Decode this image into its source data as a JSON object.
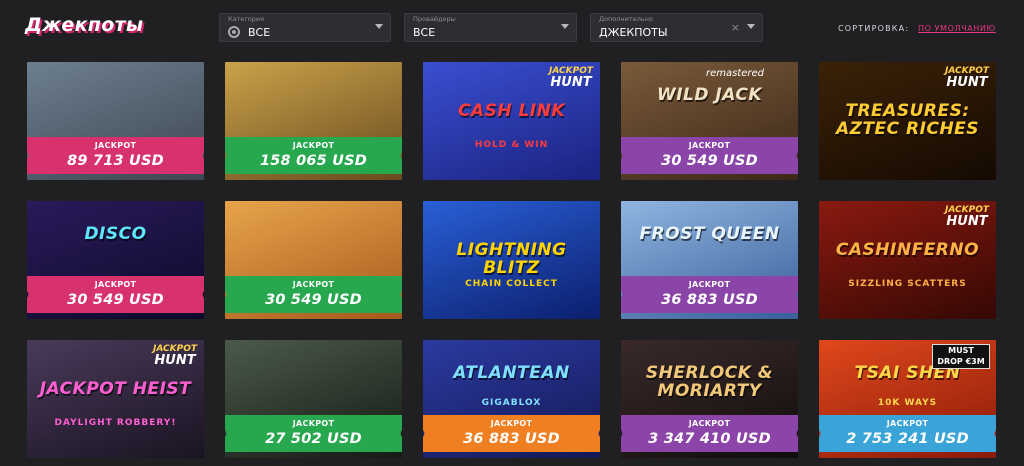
{
  "page": {
    "title": "Джекпоты"
  },
  "filters": [
    {
      "label": "Категория",
      "value": "ВСЕ",
      "has_icon": true,
      "clearable": false
    },
    {
      "label": "Провайдеры",
      "value": "ВСЕ",
      "has_icon": false,
      "clearable": false
    },
    {
      "label": "Дополнительно",
      "value": "ДЖЕКПОТЫ",
      "has_icon": false,
      "clearable": true,
      "clear_glyph": "×"
    }
  ],
  "sort": {
    "label": "СОРТИРОВКА:",
    "value": "ПО УМОЛЧАНИЮ"
  },
  "jackpot_label": "JACKPOT",
  "badges": {
    "jackpot_hunt_1": "JACKPOT",
    "jackpot_hunt_2": "HUNT",
    "remastered": "remastered",
    "must_drop_1": "MUST",
    "must_drop_2": "DROP €3M"
  },
  "games": [
    {
      "name": "",
      "sub": "",
      "art": [
        "#6d7f8f",
        "#3d4652"
      ],
      "text_color": "#fff",
      "badge": "",
      "ribbon_color": "#d8326e",
      "amount": "89 713 USD"
    },
    {
      "name": "",
      "sub": "",
      "art": [
        "#c9a24a",
        "#6a4a1e"
      ],
      "text_color": "#fff",
      "badge": "",
      "ribbon_color": "#27a74e",
      "amount": "158 065 USD"
    },
    {
      "name": "CASH LINK",
      "sub": "HOLD & WIN",
      "art": [
        "#3a4fd1",
        "#1b2280"
      ],
      "text_color": "#ff3b3b",
      "badge": "jackpot_hunt",
      "ribbon_color": "",
      "amount": ""
    },
    {
      "name": "WILD JACK",
      "sub": "",
      "art": [
        "#7a5a3a",
        "#3b2818"
      ],
      "text_color": "#f0e2c2",
      "badge": "remastered",
      "ribbon_color": "#8b45a8",
      "amount": "30 549 USD"
    },
    {
      "name": "TREASURES: AZTEC RICHES",
      "sub": "",
      "art": [
        "#3b2208",
        "#150a02"
      ],
      "text_color": "#ffcc33",
      "badge": "jackpot_hunt",
      "ribbon_color": "",
      "amount": ""
    },
    {
      "name": "DISCO",
      "sub": "",
      "art": [
        "#2a1a5a",
        "#0d0a2a"
      ],
      "text_color": "#5fe7ff",
      "badge": "",
      "ribbon_color": "#d8326e",
      "amount": "30 549 USD"
    },
    {
      "name": "",
      "sub": "",
      "art": [
        "#e8a44a",
        "#a55a1e"
      ],
      "text_color": "#fff",
      "badge": "",
      "ribbon_color": "#27a74e",
      "amount": "30 549 USD"
    },
    {
      "name": "LIGHTNING BLITZ",
      "sub": "CHAIN COLLECT",
      "art": [
        "#2a5fd6",
        "#0b1f6e"
      ],
      "text_color": "#ffd400",
      "badge": "",
      "ribbon_color": "",
      "amount": ""
    },
    {
      "name": "FROST QUEEN",
      "sub": "",
      "art": [
        "#8fb6e0",
        "#3a5e9a"
      ],
      "text_color": "#eaf6ff",
      "badge": "",
      "ribbon_color": "#8b45a8",
      "amount": "36 883 USD"
    },
    {
      "name": "CASHINFERNO",
      "sub": "SIZZLING SCATTERS",
      "art": [
        "#8a1a10",
        "#350804"
      ],
      "text_color": "#ffb347",
      "badge": "jackpot_hunt",
      "ribbon_color": "",
      "amount": ""
    },
    {
      "name": "JACKPOT HEIST",
      "sub": "DAYLIGHT ROBBERY!",
      "art": [
        "#4a3a5a",
        "#1a1422"
      ],
      "text_color": "#ff5fd1",
      "badge": "jackpot_hunt",
      "ribbon_color": "",
      "amount": ""
    },
    {
      "name": "",
      "sub": "",
      "art": [
        "#4a5a4a",
        "#151a15"
      ],
      "text_color": "#fff",
      "badge": "",
      "ribbon_color": "#27a74e",
      "amount": "27 502 USD"
    },
    {
      "name": "ATLANTEAN",
      "sub": "GIGABLOX",
      "art": [
        "#2b3aa0",
        "#151855"
      ],
      "text_color": "#7fe0ff",
      "badge": "",
      "ribbon_color": "#f07f22",
      "amount": "36 883 USD"
    },
    {
      "name": "SHERLOCK & MORIARTY",
      "sub": "",
      "art": [
        "#3a2a2a",
        "#120c0c"
      ],
      "text_color": "#f2c97a",
      "badge": "",
      "ribbon_color": "#8b45a8",
      "amount": "3 347 410 USD"
    },
    {
      "name": "TSAI SHEN",
      "sub": "10K WAYS",
      "art": [
        "#e0481c",
        "#8a1a08"
      ],
      "text_color": "#ffd84a",
      "badge": "must_drop",
      "ribbon_color": "#3aa3d8",
      "amount": "2 753 241 USD"
    }
  ]
}
